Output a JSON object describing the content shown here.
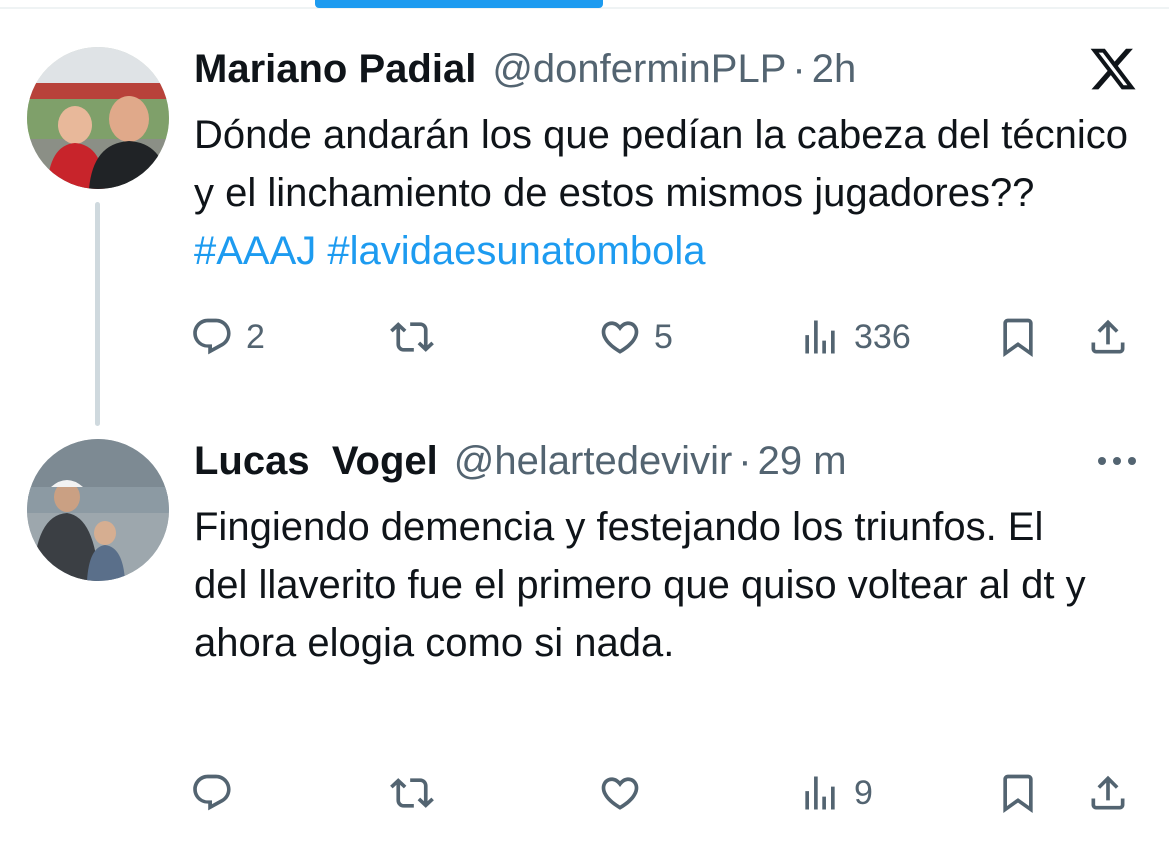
{
  "posts": [
    {
      "display_name": "Mariano Padial",
      "handle": "@donferminPLP",
      "separator": "·",
      "time": "2h",
      "text_plain": "Dónde andarán los que pedían la cabeza del técnico y el linchamiento de estos mismos jugadores?? ",
      "hashtags": [
        "#AAAJ",
        "#lavidaesunatombola"
      ],
      "actions": {
        "reply_count": "2",
        "repost_count": "",
        "like_count": "5",
        "views_count": "336"
      }
    },
    {
      "display_name": "Lucas  Vogel",
      "handle": "@helartedevivir",
      "separator": "·",
      "time": "29 m",
      "text_plain": "Fingiendo demencia y festejando los triunfos. El del llaverito fue el primero que quiso voltear al dt y ahora elogia como si nada.",
      "actions": {
        "reply_count": "",
        "repost_count": "",
        "like_count": "",
        "views_count": "9"
      }
    }
  ],
  "icons": {
    "brand": "x-logo-icon",
    "more": "more-horizontal-icon",
    "reply": "reply-icon",
    "repost": "repost-icon",
    "like": "heart-icon",
    "views": "views-icon",
    "bookmark": "bookmark-icon",
    "share": "share-icon"
  },
  "colors": {
    "text": "#0f1419",
    "secondary": "#536471",
    "hashtag": "#1d9bf0",
    "thread_line": "#cfd9de"
  }
}
